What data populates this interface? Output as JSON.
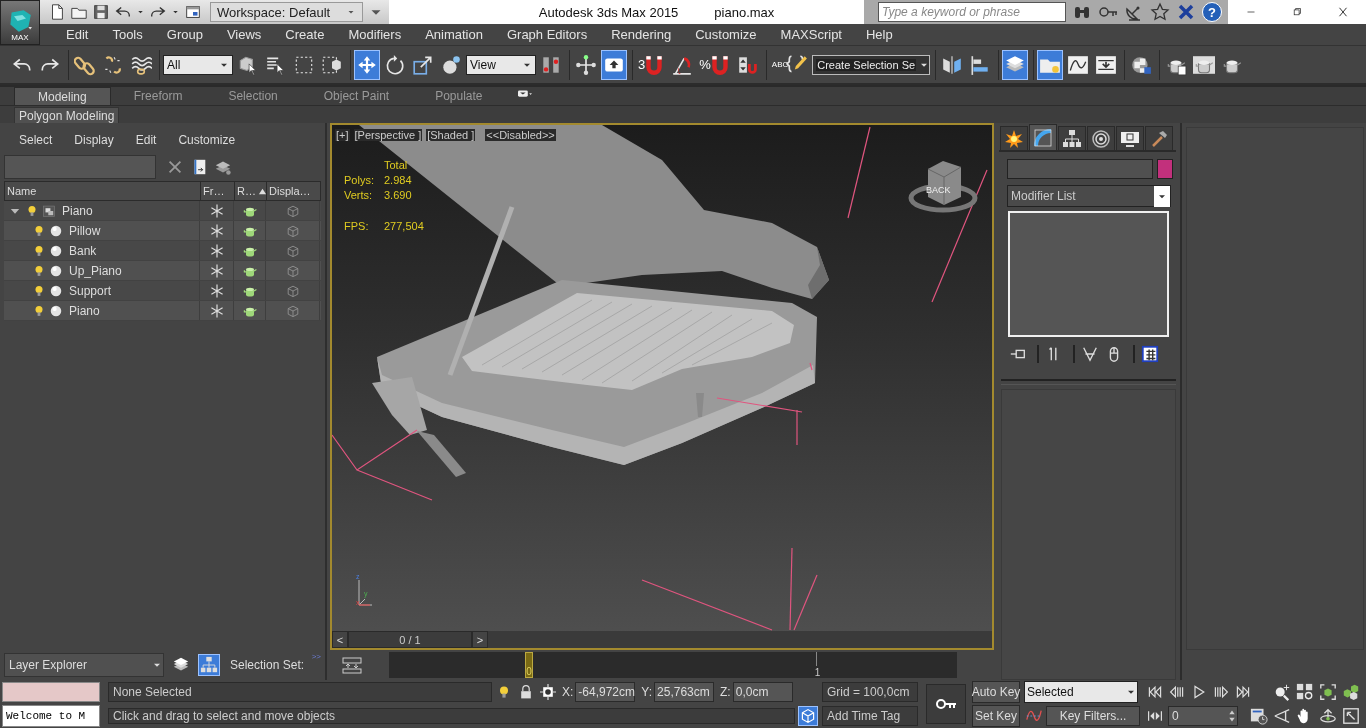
{
  "app_button": {
    "label": "MAX"
  },
  "quick_access": [
    {
      "kind": "new"
    },
    {
      "kind": "open"
    },
    {
      "kind": "save"
    },
    {
      "kind": "undo"
    },
    {
      "kind": "caret"
    },
    {
      "kind": "redo"
    },
    {
      "kind": "caret"
    },
    {
      "kind": "project"
    }
  ],
  "workspace": {
    "value": "Workspace: Default"
  },
  "window": {
    "title": "Autodesk 3ds Max  2015",
    "file": "piano.max"
  },
  "search": {
    "placeholder": "Type a keyword or phrase"
  },
  "infocenter": [
    {
      "kind": "binoculars"
    },
    {
      "kind": "key"
    },
    {
      "kind": "satellite"
    },
    {
      "kind": "star"
    },
    {
      "kind": "x-logo"
    },
    {
      "kind": "help",
      "label": "?"
    }
  ],
  "window_controls": [
    {
      "kind": "minimize"
    },
    {
      "kind": "restore"
    },
    {
      "kind": "close"
    }
  ],
  "menu": [
    "Edit",
    "Tools",
    "Group",
    "Views",
    "Create",
    "Modifiers",
    "Animation",
    "Graph Editors",
    "Rendering",
    "Customize",
    "MAXScript",
    "Help"
  ],
  "main_toolbar": [
    [
      {
        "kind": "undo",
        "selected": false
      },
      {
        "kind": "redo",
        "selected": false
      }
    ],
    [
      {
        "kind": "link",
        "selected": false
      },
      {
        "kind": "unlink",
        "selected": false
      },
      {
        "kind": "bind",
        "selected": false
      }
    ],
    [
      {
        "kind": "dropdown",
        "value": "All"
      },
      {
        "kind": "select",
        "selected": false
      },
      {
        "kind": "select-name",
        "selected": false
      },
      {
        "kind": "rect-region",
        "selected": false
      },
      {
        "kind": "window-crossing",
        "selected": false
      }
    ],
    [
      {
        "kind": "move",
        "selected": true
      },
      {
        "kind": "rotate",
        "selected": false
      },
      {
        "kind": "scale",
        "selected": false
      },
      {
        "kind": "placement",
        "selected": false
      },
      {
        "kind": "dropdown",
        "value": "View"
      },
      {
        "kind": "pivot",
        "selected": false
      }
    ],
    [
      {
        "kind": "manipulate",
        "selected": false
      },
      {
        "kind": "keyboard",
        "selected": true
      }
    ],
    [
      {
        "kind": "snap",
        "label": "3",
        "selected": false
      },
      {
        "kind": "angle-snap",
        "selected": false
      },
      {
        "kind": "snap",
        "label": "%",
        "selected": false
      },
      {
        "kind": "spinner-snap",
        "selected": false
      }
    ],
    [
      {
        "kind": "named-selection",
        "label": "ABC",
        "selected": false
      },
      {
        "kind": "dark-dropdown",
        "value": "Create Selection Se"
      }
    ],
    [
      {
        "kind": "mirror",
        "selected": false
      },
      {
        "kind": "align",
        "selected": false
      }
    ],
    [
      {
        "kind": "layers",
        "selected": true
      }
    ],
    [
      {
        "kind": "scene-explorer",
        "selected": true
      },
      {
        "kind": "curve-editor",
        "selected": false
      },
      {
        "kind": "schematic",
        "selected": false
      }
    ],
    [
      {
        "kind": "material",
        "selected": false
      }
    ],
    [
      {
        "kind": "render-setup",
        "selected": false
      },
      {
        "kind": "rendered-frame",
        "selected": false
      },
      {
        "kind": "render",
        "selected": false
      }
    ]
  ],
  "ribbon": {
    "tabs": [
      {
        "label": "Modeling",
        "selected": true
      },
      {
        "label": "Freeform",
        "selected": false
      },
      {
        "label": "Selection",
        "selected": false
      },
      {
        "label": "Object Paint",
        "selected": false
      },
      {
        "label": "Populate",
        "selected": false
      }
    ],
    "panel": "Polygon Modeling"
  },
  "scene_explorer": {
    "menu": [
      "Select",
      "Display",
      "Edit",
      "Customize"
    ],
    "tools": [
      {
        "kind": "clear"
      },
      {
        "kind": "filter-panel"
      },
      {
        "kind": "layers-gear"
      }
    ],
    "columns": [
      {
        "label": "Name",
        "sorted": false
      },
      {
        "label": "Fr…",
        "sorted": false
      },
      {
        "label": "R…",
        "sorted": true
      },
      {
        "label": "Displa…",
        "sorted": false
      }
    ],
    "tree": [
      {
        "name": "Piano",
        "kind": "group",
        "expanded": true,
        "children": [
          {
            "name": "Pillow",
            "kind": "object"
          },
          {
            "name": "Bank",
            "kind": "object"
          },
          {
            "name": "Up_Piano",
            "kind": "object"
          },
          {
            "name": "Support",
            "kind": "object"
          },
          {
            "name": "Piano",
            "kind": "object"
          }
        ]
      }
    ]
  },
  "viewport": {
    "labels": [
      "[+]",
      "[Perspective ]",
      "[Shaded ]",
      "<<Disabled>>"
    ],
    "stats": {
      "header": "Total",
      "rows": [
        {
          "label": "Polys:",
          "value": "2.984"
        },
        {
          "label": "Verts:",
          "value": "3.690"
        }
      ],
      "fps": {
        "label": "FPS:",
        "value": "277,504"
      }
    },
    "viewcube": {
      "label": "BACK"
    },
    "axes": [
      "x",
      "y",
      "z"
    ]
  },
  "time_slider": {
    "prev": "<",
    "position": "0 / 1",
    "next": ">",
    "level": 0
  },
  "command_panel": {
    "tabs": [
      {
        "kind": "create",
        "selected": false
      },
      {
        "kind": "modify",
        "selected": true
      },
      {
        "kind": "hierarchy",
        "selected": false
      },
      {
        "kind": "motion",
        "selected": false
      },
      {
        "kind": "display",
        "selected": false
      },
      {
        "kind": "utilities",
        "selected": false
      }
    ],
    "swatch": {
      "color": "#c2307c"
    },
    "modifier_list": "Modifier List",
    "stack_tools": [
      [
        {
          "kind": "pin"
        }
      ],
      [
        {
          "kind": "show-end"
        }
      ],
      [
        {
          "kind": "make-unique"
        },
        {
          "kind": "remove"
        }
      ],
      [
        {
          "kind": "configure"
        }
      ]
    ]
  },
  "layer_bar": {
    "dropdown": "Layer Explorer",
    "tools": [
      {
        "kind": "layers",
        "selected": false
      },
      {
        "kind": "hierarchy",
        "selected": true
      }
    ],
    "selection_set": "Selection Set:",
    "expand": ">>"
  },
  "trackbar": {
    "current": "0",
    "end": "1"
  },
  "status": {
    "listener_output": "Welcome to M",
    "selection": "None Selected",
    "prompt": "Click and drag to select and move objects",
    "coords": [
      {
        "axis": "X:",
        "value": "-64,972cm"
      },
      {
        "axis": "Y:",
        "value": "25,763cm"
      },
      {
        "axis": "Z:",
        "value": "0,0cm"
      }
    ],
    "grid": "Grid = 100,0cm",
    "time_tag": "Add Time Tag"
  },
  "animation": {
    "auto_key": "Auto Key",
    "set_key": "Set Key",
    "key_mode": "Selected",
    "key_filters": "Key Filters...",
    "frame": "0"
  },
  "transport": [
    {
      "kind": "go-start"
    },
    {
      "kind": "prev-frame"
    },
    {
      "kind": "play"
    },
    {
      "kind": "next-frame"
    },
    {
      "kind": "go-end"
    }
  ],
  "key_mode_toggle": {
    "kind": "key-mode"
  },
  "viewport_navigation": [
    [
      {
        "kind": "zoom"
      },
      {
        "kind": "zoom-all"
      },
      {
        "kind": "zoom-extents"
      },
      {
        "kind": "zoom-extents-all"
      }
    ],
    [
      {
        "kind": "time-config"
      },
      {
        "kind": "fov"
      },
      {
        "kind": "pan"
      },
      {
        "kind": "orbit"
      },
      {
        "kind": "maximize"
      }
    ]
  ]
}
